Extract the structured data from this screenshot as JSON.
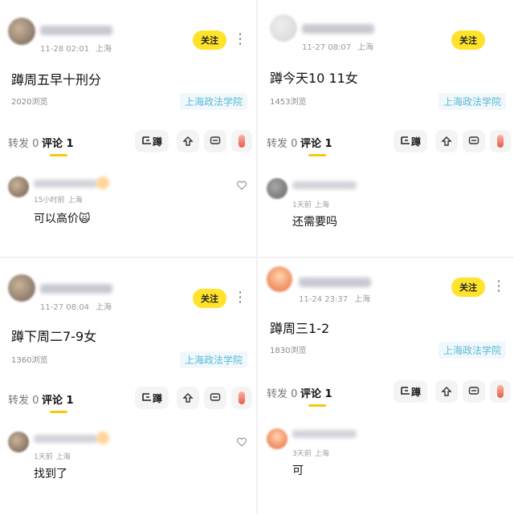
{
  "colors": {
    "follow_bg": "#ffe32b",
    "school_text": "#59b9d6",
    "underline": "#f5c80a"
  },
  "icons": {
    "share": "share-up-icon",
    "message": "chat-bubble-icon",
    "more": "vertical-dots-icon",
    "like": "heart-outline-icon"
  },
  "panels": [
    {
      "time": "11-28 02:01",
      "location": "上海",
      "follow": "关注",
      "content": "蹲周五早十刑分",
      "views": "2020浏览",
      "school": "上海政法学院",
      "tabs": {
        "repost": "转发 0",
        "comment": "评论 1"
      },
      "dun": "蹲",
      "comment": {
        "time": "15小时前",
        "location": "上海",
        "text": "可以高价🙀"
      }
    },
    {
      "time": "11-27 08:07",
      "location": "上海",
      "follow": "关注",
      "content": "蹲今天10 11女",
      "views": "1453浏览",
      "school": "上海政法学院",
      "tabs": {
        "repost": "转发 0",
        "comment": "评论 1"
      },
      "dun": "蹲",
      "comment": {
        "time": "1天前",
        "location": "上海",
        "text": "还需要吗"
      }
    },
    {
      "time": "11-27 08:04",
      "location": "上海",
      "follow": "关注",
      "content": "蹲下周二7-9女",
      "views": "1360浏览",
      "school": "上海政法学院",
      "tabs": {
        "repost": "转发 0",
        "comment": "评论 1"
      },
      "dun": "蹲",
      "comment": {
        "time": "1天前",
        "location": "上海",
        "text": "找到了"
      }
    },
    {
      "time": "11-24 23:37",
      "location": "上海",
      "follow": "关注",
      "content": "蹲周三1-2",
      "views": "1830浏览",
      "school": "上海政法学院",
      "tabs": {
        "repost": "转发 0",
        "comment": "评论 1"
      },
      "dun": "蹲",
      "comment": {
        "time": "3天前",
        "location": "上海",
        "text": "可"
      }
    }
  ]
}
